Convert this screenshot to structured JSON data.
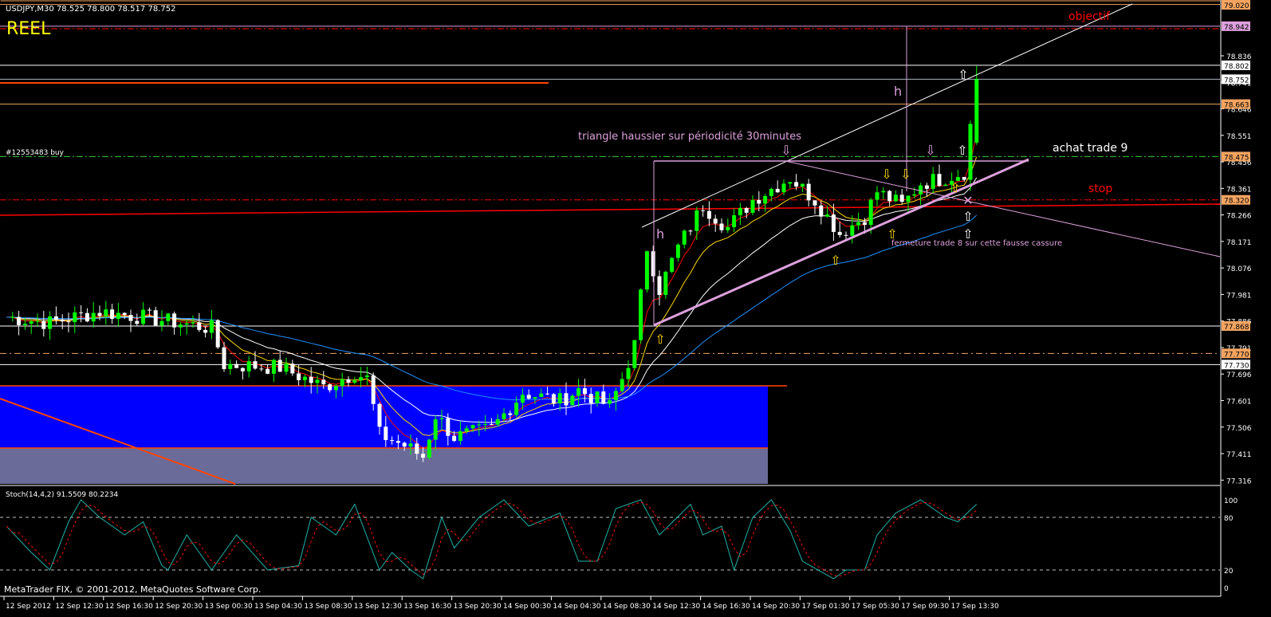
{
  "header": {
    "symbol_info": "USDJPY,M30  78.525 78.800 78.517 78.752",
    "account_label": "REEL"
  },
  "order_label": "#12553483 buy",
  "indicator_label": "Stoch(14,4,2) 91.5509 80.2234",
  "copyright": "MetaTrader FIX, © 2001-2012, MetaQuotes Software Corp.",
  "annotations": {
    "objectif": "objectif",
    "achat": "achat trade 9",
    "stop": "stop",
    "triangle": "triangle haussier sur périodicité 30minutes",
    "fermeture": "fermeture trade 8 sur cette fausse cassure",
    "h1": "h",
    "h2": "h"
  },
  "colors": {
    "up": "#00ff00",
    "down": "#ffffff",
    "bg": "#000000",
    "zone_blue": "#0000ff",
    "zone_grey": "#6b6b9a",
    "label_orange": "#f4a460"
  },
  "chart_data": {
    "type": "candlestick",
    "symbol": "USDJPY",
    "timeframe": "M30",
    "ylim": [
      77.316,
      79.02
    ],
    "price_ticks": [
      "78.836",
      "78.741",
      "78.646",
      "78.551",
      "78.456",
      "78.361",
      "78.266",
      "78.171",
      "78.076",
      "77.981",
      "77.886",
      "77.791",
      "77.696",
      "77.601",
      "77.506",
      "77.411",
      "77.316"
    ],
    "price_labels": [
      {
        "value": "79.020",
        "color": "#f4a460"
      },
      {
        "value": "78.942",
        "color": "#dda0dd"
      },
      {
        "value": "78.802",
        "color": "#ffffff"
      },
      {
        "value": "78.752",
        "color": "#ffffff"
      },
      {
        "value": "78.663",
        "color": "#f4a460"
      },
      {
        "value": "78.475",
        "color": "#f4a460"
      },
      {
        "value": "78.320",
        "color": "#f4a460"
      },
      {
        "value": "77.868",
        "color": "#f4a460"
      },
      {
        "value": "77.770",
        "color": "#f4a460"
      },
      {
        "value": "77.730",
        "color": "#ffffff"
      }
    ],
    "time_labels": [
      "12 Sep 2012",
      "12 Sep 12:30",
      "12 Sep 16:30",
      "12 Sep 20:30",
      "13 Sep 00:30",
      "13 Sep 04:30",
      "13 Sep 08:30",
      "13 Sep 12:30",
      "13 Sep 16:30",
      "13 Sep 20:30",
      "14 Sep 00:30",
      "14 Sep 04:30",
      "14 Sep 08:30",
      "14 Sep 12:30",
      "14 Sep 16:30",
      "14 Sep 20:30",
      "17 Sep 01:30",
      "17 Sep 05:30",
      "17 Sep 09:30",
      "17 Sep 13:30"
    ],
    "close_keypoints_bar_price": [
      [
        0,
        77.9
      ],
      [
        7,
        77.88
      ],
      [
        15,
        77.92
      ],
      [
        22,
        77.9
      ],
      [
        33,
        77.86
      ],
      [
        35,
        77.73
      ],
      [
        44,
        77.72
      ],
      [
        51,
        77.65
      ],
      [
        56,
        77.7
      ],
      [
        58,
        77.68
      ],
      [
        60,
        77.48
      ],
      [
        64,
        77.44
      ],
      [
        67,
        77.4
      ],
      [
        69,
        77.55
      ],
      [
        72,
        77.47
      ],
      [
        78,
        77.5
      ],
      [
        83,
        77.63
      ],
      [
        89,
        77.6
      ],
      [
        92,
        77.64
      ],
      [
        97,
        77.58
      ],
      [
        99,
        77.68
      ],
      [
        101,
        77.8
      ],
      [
        103,
        78.15
      ],
      [
        105,
        78.0
      ],
      [
        108,
        78.15
      ],
      [
        112,
        78.3
      ],
      [
        116,
        78.22
      ],
      [
        120,
        78.32
      ],
      [
        126,
        78.4
      ],
      [
        130,
        78.32
      ],
      [
        134,
        78.2
      ],
      [
        138,
        78.26
      ],
      [
        140,
        78.35
      ],
      [
        144,
        78.3
      ],
      [
        147,
        78.38
      ],
      [
        151,
        78.4
      ],
      [
        154,
        78.42
      ],
      [
        156,
        78.752
      ]
    ],
    "last_bar": {
      "open": 78.525,
      "high": 78.8,
      "low": 78.517,
      "close": 78.752
    },
    "stoch": {
      "label": "Stoch(14,4,2)",
      "main": 91.5509,
      "signal": 80.2234,
      "levels": [
        20,
        80
      ],
      "ylim": [
        0,
        100
      ],
      "ticks": [
        "100",
        "80",
        "20",
        "0"
      ],
      "main_keypoints_bar_value": [
        [
          0,
          70
        ],
        [
          4,
          40
        ],
        [
          7,
          20
        ],
        [
          10,
          75
        ],
        [
          12,
          100
        ],
        [
          15,
          80
        ],
        [
          19,
          60
        ],
        [
          22,
          75
        ],
        [
          25,
          25
        ],
        [
          26,
          20
        ],
        [
          29,
          60
        ],
        [
          33,
          20
        ],
        [
          37,
          60
        ],
        [
          42,
          20
        ],
        [
          47,
          25
        ],
        [
          49,
          80
        ],
        [
          53,
          60
        ],
        [
          56,
          95
        ],
        [
          60,
          20
        ],
        [
          62,
          40
        ],
        [
          65,
          20
        ],
        [
          67,
          10
        ],
        [
          70,
          80
        ],
        [
          72,
          45
        ],
        [
          76,
          80
        ],
        [
          80,
          100
        ],
        [
          84,
          70
        ],
        [
          89,
          85
        ],
        [
          92,
          30
        ],
        [
          95,
          30
        ],
        [
          98,
          90
        ],
        [
          102,
          100
        ],
        [
          105,
          60
        ],
        [
          110,
          95
        ],
        [
          112,
          60
        ],
        [
          115,
          70
        ],
        [
          117,
          20
        ],
        [
          120,
          80
        ],
        [
          123,
          100
        ],
        [
          126,
          65
        ],
        [
          128,
          30
        ],
        [
          133,
          10
        ],
        [
          135,
          20
        ],
        [
          138,
          20
        ],
        [
          140,
          60
        ],
        [
          143,
          85
        ],
        [
          147,
          100
        ],
        [
          151,
          80
        ],
        [
          153,
          75
        ],
        [
          156,
          95
        ]
      ]
    }
  }
}
